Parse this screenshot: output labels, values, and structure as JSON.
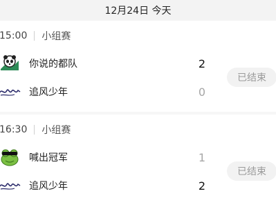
{
  "date_header": "12月24日 今天",
  "matches": [
    {
      "time": "15:00",
      "stage": "小组赛",
      "status": "已结束",
      "teams": [
        {
          "name": "你说的都队",
          "score": "2",
          "logo_icon": "panda-logo-icon"
        },
        {
          "name": "追风少年",
          "score": "0",
          "logo_icon": "script-logo-icon"
        }
      ]
    },
    {
      "time": "16:30",
      "stage": "小组赛",
      "status": "已结束",
      "teams": [
        {
          "name": "喊出冠军",
          "score": "1",
          "logo_icon": "frog-logo-icon"
        },
        {
          "name": "追风少年",
          "score": "2",
          "logo_icon": "script-logo-icon"
        }
      ]
    }
  ]
}
